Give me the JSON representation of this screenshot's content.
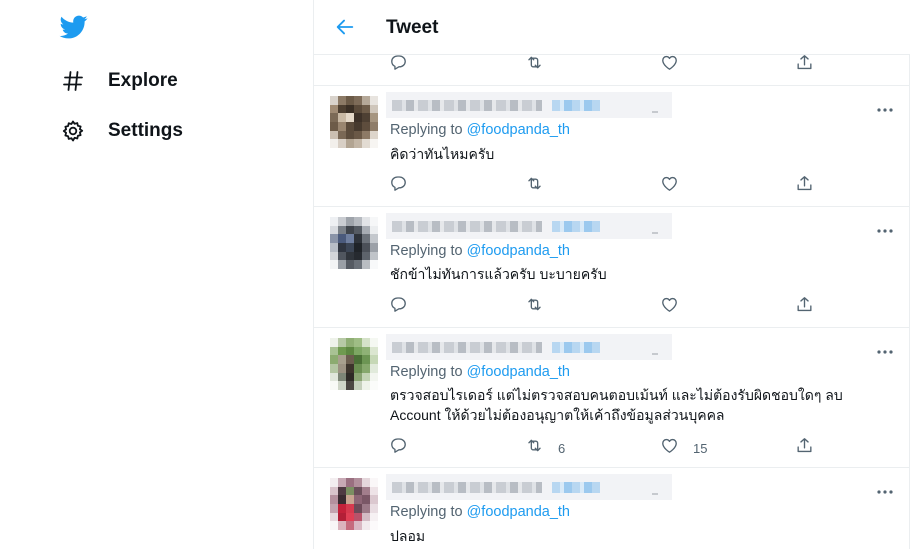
{
  "nav": {
    "explore_label": "Explore",
    "settings_label": "Settings"
  },
  "header": {
    "title": "Tweet"
  },
  "tweets": [
    {
      "replying_prefix": "Replying to ",
      "replying_handle": "@foodpanda_th",
      "text": "คิดว่าทันไหมครับ",
      "retweets": "",
      "likes": ""
    },
    {
      "replying_prefix": "Replying to ",
      "replying_handle": "@foodpanda_th",
      "text": "ชักข้าไม่ทันการแล้วครับ บะบายครับ",
      "retweets": "",
      "likes": ""
    },
    {
      "replying_prefix": "Replying to ",
      "replying_handle": "@foodpanda_th",
      "text_line1": "ตรวจสอบไรเดอร์  แต่ไม่ตรวจสอบคนตอบเม้นท์ และไม่ต้องรับผิดชอบใดๆ ลบ",
      "text_line2": "Account ให้ด้วยไม่ต้องอนุญาตให้เค้าถึงข้อมูลส่วนบุคคล",
      "retweets": "6",
      "likes": "15"
    },
    {
      "replying_prefix": "Replying to ",
      "replying_handle": "@foodpanda_th",
      "text": "ปลอม"
    }
  ],
  "colors": {
    "brand": "#1d9bf0",
    "text": "#0f1419",
    "muted": "#536471",
    "divider": "#ebeef0"
  },
  "icons": [
    "twitter-bird-icon",
    "hashtag-icon",
    "gear-icon",
    "back-arrow-icon",
    "reply-icon",
    "retweet-icon",
    "like-icon",
    "share-icon",
    "more-icon"
  ]
}
